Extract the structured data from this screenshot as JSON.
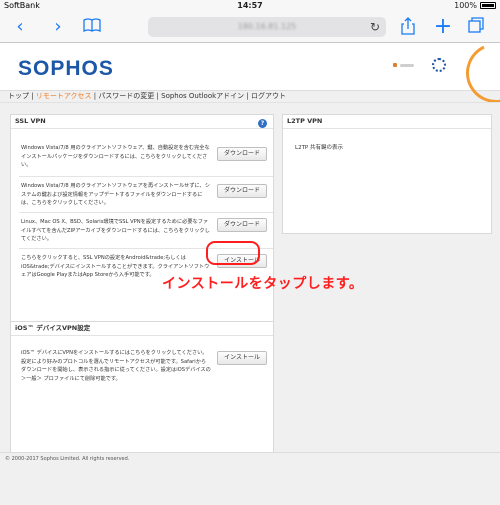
{
  "status_bar": {
    "carrier": "SoftBank",
    "time": "14:57",
    "battery": "100%"
  },
  "browser": {
    "url": "180.16.81.125"
  },
  "header": {
    "logo": "SOPHOS"
  },
  "nav": {
    "items": [
      {
        "label": "トップ",
        "active": false
      },
      {
        "label": "リモートアクセス",
        "active": true
      },
      {
        "label": "パスワードの変更",
        "active": false
      },
      {
        "label": "Sophos Outlookアドイン",
        "active": false
      },
      {
        "label": "ログアウト",
        "active": false
      }
    ]
  },
  "ssl_panel": {
    "title": "SSL VPN",
    "rows": [
      {
        "text": "Windows Vista/7/8 用のクライアントソフトウェア、鍵、自動設定を含む完全なインストールパッケージをダウンロードするには、こちらをクリックしてください。",
        "button": "ダウンロード"
      },
      {
        "text": "Windows Vista/7/8 用のクライアントソフトウェアを再インストールせずに、システムの鍵および設定情報をアップデートするファイルをダウンロードするには、こちらをクリックしてください。",
        "button": "ダウンロード"
      },
      {
        "text": "Linux、Mac OS X、BSD、Solaris環境でSSL VPNを設定するために必要なファイルすべてを含んだZIPアーカイブをダウンロードするには、こちらをクリックしてください。",
        "button": "ダウンロード"
      },
      {
        "text": "こちらをクリックすると、SSL VPNの設定をAndroid&trade;もしくはiOS&trade;デバイスにインストールすることができます。クライアントソフトウェアはGoogle PlayまたはApp Storeから入手可能です。",
        "button": "インストール"
      }
    ]
  },
  "ios_panel": {
    "title": "iOS™ デバイスVPN設定",
    "row": {
      "text": "iOS™ デバイスにVPNをインストールするにはこちらをクリックしてください。設定により好みのプロトコルを選んでリモートアクセスが可能です。Safariからダウンロードを開始し、表示される指示に従ってください。設定はiOSデバイスの ＞一般＞ プロファイルにて削除可能です。",
      "button": "インストール"
    }
  },
  "l2tp_panel": {
    "title": "L2TP VPN",
    "text": "L2TP 共有鍵の表示"
  },
  "annotation": "インストールをタップします。",
  "footer": "© 2000-2017 Sophos Limited. All rights reserved.",
  "colors": {
    "brand": "#1d57a7",
    "accent": "#f07a20",
    "annotation": "#ff1e1e",
    "ios_blue": "#1a7cf5"
  }
}
